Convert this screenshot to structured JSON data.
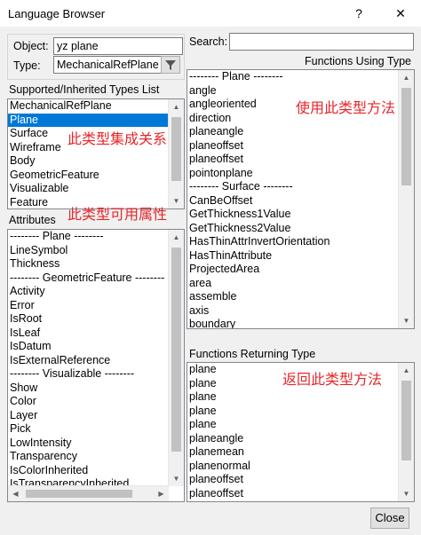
{
  "window": {
    "title": "Language Browser",
    "help_glyph": "?",
    "close_glyph": "✕"
  },
  "object_group": {
    "object_label": "Object:",
    "object_value": "yz plane",
    "type_label": "Type:",
    "type_value": "MechanicalRefPlane"
  },
  "search": {
    "label": "Search:",
    "value": ""
  },
  "supported_types": {
    "header": "Supported/Inherited Types List",
    "items": [
      "MechanicalRefPlane",
      "Plane",
      "Surface",
      "Wireframe",
      "Body",
      "GeometricFeature",
      "Visualizable",
      "Feature"
    ],
    "selected_index": 1
  },
  "attributes": {
    "header": "Attributes",
    "items": [
      "-------- Plane --------",
      "LineSymbol",
      "Thickness",
      "-------- GeometricFeature --------",
      "Activity",
      "Error",
      "IsRoot",
      "IsLeaf",
      "IsDatum",
      "IsExternalReference",
      "-------- Visualizable --------",
      "Show",
      "Color",
      "Layer",
      "Pick",
      "LowIntensity",
      "Transparency",
      "IsColorInherited",
      "IsTransparencyInherited"
    ]
  },
  "functions_using": {
    "header": "Functions Using Type",
    "items": [
      "-------- Plane --------",
      "angle",
      "angleoriented",
      "direction",
      "planeangle",
      "planeoffset",
      "planeoffset",
      "pointonplane",
      "-------- Surface --------",
      "CanBeOffset",
      "GetThickness1Value",
      "GetThickness2Value",
      "HasThinAttrInvertOrientation",
      "HasThinAttribute",
      "ProjectedArea",
      "area",
      "assemble",
      "axis",
      "boundary"
    ]
  },
  "functions_returning": {
    "header": "Functions Returning Type",
    "items": [
      "plane",
      "plane",
      "plane",
      "plane",
      "plane",
      "planeangle",
      "planemean",
      "planenormal",
      "planeoffset",
      "planeoffset"
    ]
  },
  "annotations": {
    "inherited": "此类型集成关系",
    "attributes": "此类型可用属性",
    "using": "使用此类型方法",
    "returning": "返回此类型方法"
  },
  "buttons": {
    "close": "Close"
  },
  "icons": {
    "filter": "funnel-icon"
  },
  "colors": {
    "selection": "#0078d7",
    "annotation": "#e8262a",
    "background": "#f0f0f0"
  }
}
